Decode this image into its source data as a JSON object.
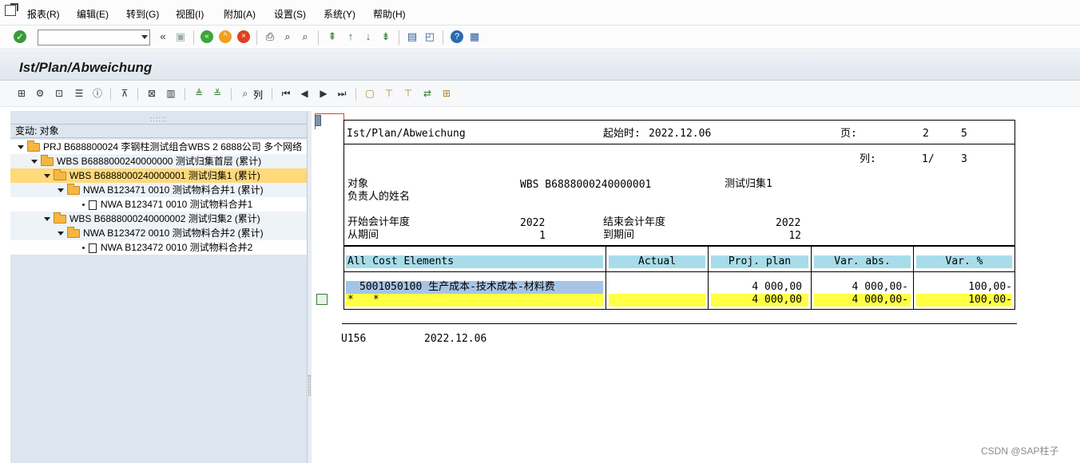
{
  "menu": {
    "items": [
      "报表(R)",
      "编辑(E)",
      "转到(G)",
      "视图(I)",
      "附加(A)",
      "设置(S)",
      "系统(Y)",
      "帮助(H)"
    ]
  },
  "system_toolbar": {
    "command_value": "",
    "icons": [
      "enter-icon",
      "back-icon",
      "exit-icon",
      "cancel-icon",
      "print-icon",
      "find-icon",
      "find-next-icon",
      "first-page-icon",
      "prev-page-icon",
      "next-page-icon",
      "last-page-icon",
      "new-session-icon",
      "shortcut-icon",
      "help-icon",
      "layout-icon"
    ]
  },
  "title": "Ist/Plan/Abweichung",
  "app_toolbar": {
    "columns_label": "列"
  },
  "tree": {
    "header": "变动:  对象",
    "rows": [
      {
        "level": 0,
        "kind": "folder",
        "label": "PRJ B688800024 李钢柱测试组合WBS 2  6888公司 多个网络"
      },
      {
        "level": 1,
        "kind": "folder",
        "label": "WBS B6888000240000000 测试归集首层 (累计)"
      },
      {
        "level": 2,
        "kind": "folder",
        "label": "WBS B6888000240000001 测试归集1 (累计)",
        "selected": true
      },
      {
        "level": 3,
        "kind": "folder",
        "label": "NWA B123471 0010 测试物料合并1 (累计)"
      },
      {
        "level": 4,
        "kind": "doc",
        "label": "NWA B123471 0010 测试物料合并1"
      },
      {
        "level": 2,
        "kind": "folder",
        "label": "WBS B6888000240000002 测试归集2 (累计)"
      },
      {
        "level": 3,
        "kind": "folder",
        "label": "NWA B123472 0010 测试物料合并2 (累计)"
      },
      {
        "level": 4,
        "kind": "doc",
        "label": "NWA B123472 0010 测试物料合并2"
      }
    ]
  },
  "report": {
    "title": "Ist/Plan/Abweichung",
    "start_label": "起始时:",
    "start_value": "2022.12.06",
    "page_label": "页:",
    "page_current": "2",
    "page_total": "5",
    "col_label": "列:",
    "col_current": "1/",
    "col_total": "3",
    "object_label": "对象",
    "object_value": "WBS B6888000240000001",
    "object_desc": "测试归集1",
    "responsible_label": "负责人的姓名",
    "from_year_label": "开始会计年度",
    "from_year_value": "2022",
    "to_year_label": "结束会计年度",
    "to_year_value": "2022",
    "from_period_label": "从期间",
    "from_period_value": "1",
    "to_period_label": "到期间",
    "to_period_value": "12",
    "headers": [
      "All Cost Elements",
      "Actual",
      "Proj. plan",
      "Var. abs.",
      "Var. %"
    ],
    "line": {
      "element": "5001050100  生产成本-技术成本-材料费",
      "actual": "",
      "plan": "4 000,00",
      "var_abs": "4 000,00-",
      "var_pct": "100,00-"
    },
    "total": {
      "marker1": "*",
      "marker2": "*",
      "actual": "",
      "plan": "4 000,00",
      "var_abs": "4 000,00-",
      "var_pct": "100,00-"
    },
    "footer_user": "U156",
    "footer_date": "2022.12.06"
  },
  "watermark": "CSDN @SAP柱子"
}
